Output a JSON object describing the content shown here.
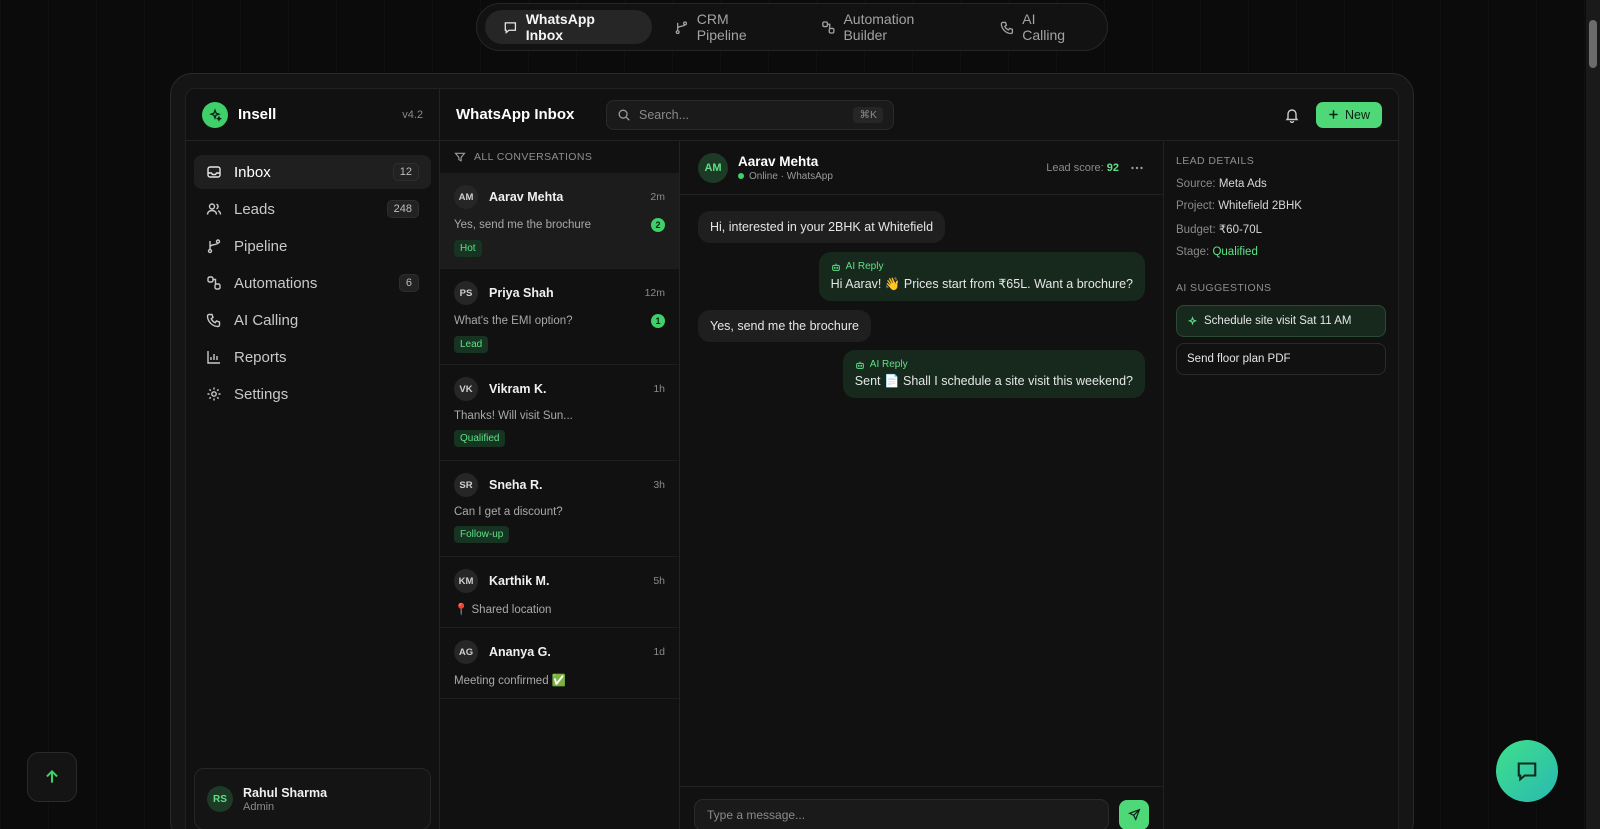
{
  "top_tabs": [
    {
      "label": "WhatsApp Inbox",
      "icon": "chat-icon",
      "active": true
    },
    {
      "label": "CRM Pipeline",
      "icon": "branch-icon",
      "active": false
    },
    {
      "label": "Automation Builder",
      "icon": "workflow-icon",
      "active": false
    },
    {
      "label": "AI Calling",
      "icon": "phone-icon",
      "active": false
    }
  ],
  "brand": {
    "name": "Insell",
    "version": "v4.2",
    "accent": "#3fd06a"
  },
  "sidebar": {
    "items": [
      {
        "label": "Inbox",
        "count": "12",
        "icon": "inbox-icon"
      },
      {
        "label": "Leads",
        "count": "248",
        "icon": "users-icon"
      },
      {
        "label": "Pipeline",
        "count": "",
        "icon": "branch-icon"
      },
      {
        "label": "Automations",
        "count": "6",
        "icon": "workflow-icon"
      },
      {
        "label": "AI Calling",
        "count": "",
        "icon": "phone-icon"
      },
      {
        "label": "Reports",
        "count": "",
        "icon": "bar-chart-icon"
      },
      {
        "label": "Settings",
        "count": "",
        "icon": "gear-icon"
      }
    ],
    "user": {
      "initials": "RS",
      "name": "Rahul Sharma",
      "role": "Admin"
    }
  },
  "header": {
    "title": "WhatsApp Inbox",
    "search_placeholder": "Search...",
    "shortcut": "⌘K",
    "new_label": "New"
  },
  "conversations": {
    "header": "ALL CONVERSATIONS",
    "items": [
      {
        "initials": "AM",
        "name": "Aarav Mehta",
        "time": "2m",
        "preview": "Yes, send me the brochure",
        "unread": "2",
        "tag": "Hot"
      },
      {
        "initials": "PS",
        "name": "Priya Shah",
        "time": "12m",
        "preview": "What's the EMI option?",
        "unread": "1",
        "tag": "Lead"
      },
      {
        "initials": "VK",
        "name": "Vikram K.",
        "time": "1h",
        "preview": "Thanks! Will visit Sun...",
        "unread": "",
        "tag": "Qualified"
      },
      {
        "initials": "SR",
        "name": "Sneha R.",
        "time": "3h",
        "preview": "Can I get a discount?",
        "unread": "",
        "tag": "Follow-up"
      },
      {
        "initials": "KM",
        "name": "Karthik M.",
        "time": "5h",
        "preview": "📍 Shared location",
        "unread": "",
        "tag": ""
      },
      {
        "initials": "AG",
        "name": "Ananya G.",
        "time": "1d",
        "preview": "Meeting confirmed ✅",
        "unread": "",
        "tag": ""
      }
    ]
  },
  "chat": {
    "initials": "AM",
    "name": "Aarav Mehta",
    "status": "Online · WhatsApp",
    "lead_score_label": "Lead score:",
    "lead_score": "92",
    "messages": [
      {
        "dir": "in",
        "text": "Hi, interested in your 2BHK at Whitefield"
      },
      {
        "dir": "out",
        "label": "AI Reply",
        "text": "Hi Aarav! 👋 Prices start from ₹65L. Want a brochure?"
      },
      {
        "dir": "in",
        "text": "Yes, send me the brochure"
      },
      {
        "dir": "out",
        "label": "AI Reply",
        "text": "Sent 📄 Shall I schedule a site visit this weekend?"
      }
    ],
    "composer_placeholder": "Type a message..."
  },
  "details": {
    "lead_title": "LEAD DETAILS",
    "rows": [
      {
        "label": "Source:",
        "value": "Meta Ads"
      },
      {
        "label": "Project:",
        "value": "Whitefield 2BHK"
      },
      {
        "label": "Budget:",
        "value": "₹60-70L"
      },
      {
        "label": "Stage:",
        "value": "Qualified"
      }
    ],
    "ai_title": "AI SUGGESTIONS",
    "suggestions": [
      "Schedule site visit Sat 11 AM",
      "Send floor plan PDF"
    ]
  }
}
